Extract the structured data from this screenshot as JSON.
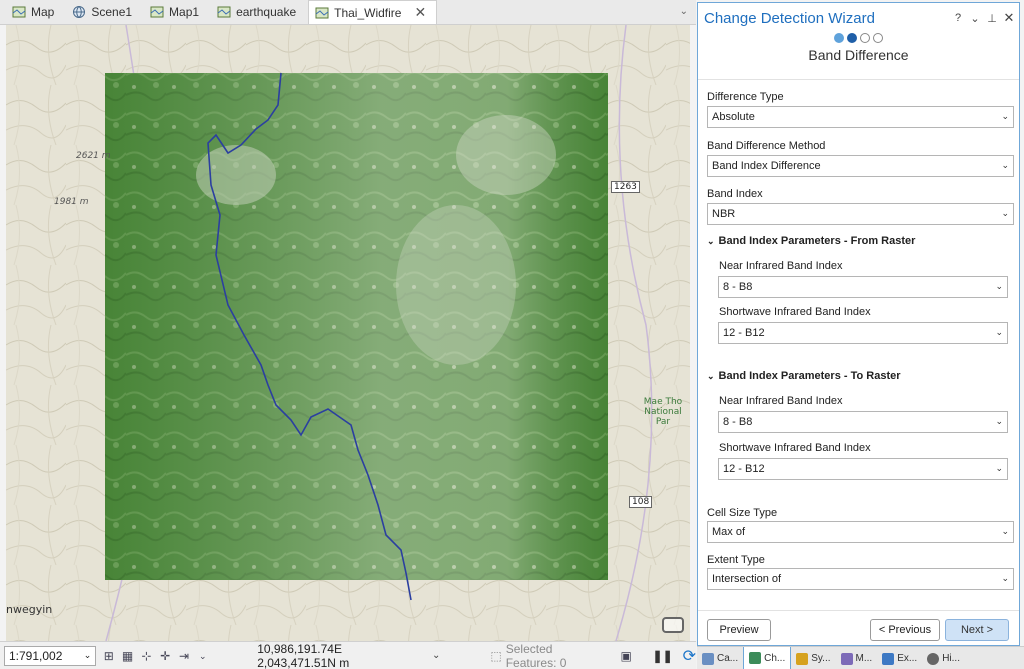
{
  "tabs": [
    {
      "label": "Map",
      "icon": "map-icon",
      "active": false
    },
    {
      "label": "Scene1",
      "icon": "globe-icon",
      "active": false
    },
    {
      "label": "Map1",
      "icon": "map-icon",
      "active": false
    },
    {
      "label": "earthquake",
      "icon": "map-icon",
      "active": false
    },
    {
      "label": "Thai_Widfire",
      "icon": "map-icon",
      "active": true
    }
  ],
  "map": {
    "labels": [
      "2621 m",
      "1981 m",
      "nwegyin",
      "Mae Tho National Par"
    ],
    "road_shields": [
      "1263",
      "108"
    ],
    "river_color": "#2b3fa0",
    "imagery_color": "#4a7d3a"
  },
  "status": {
    "scale": "1:791,002",
    "coordinates": "10,986,191.74E 2,043,471.51N m",
    "selected_features": "Selected Features: 0"
  },
  "panel": {
    "title": "Change Detection Wizard",
    "header_buttons": [
      "?",
      "v",
      "⊥",
      "✕"
    ],
    "steps_total": 4,
    "current_step": 2,
    "step_title": "Band Difference",
    "difference_type": {
      "label": "Difference Type",
      "value": "Absolute"
    },
    "band_difference_method": {
      "label": "Band Difference Method",
      "value": "Band Index Difference"
    },
    "band_index": {
      "label": "Band Index",
      "value": "NBR"
    },
    "from_raster": {
      "heading": "Band Index Parameters - From Raster",
      "nir_label": "Near Infrared Band Index",
      "nir_value": "8 - B8",
      "swir_label": "Shortwave Infrared Band Index",
      "swir_value": "12 - B12"
    },
    "to_raster": {
      "heading": "Band Index Parameters - To Raster",
      "nir_label": "Near Infrared Band Index",
      "nir_value": "8 - B8",
      "swir_label": "Shortwave Infrared Band Index",
      "swir_value": "12 - B12"
    },
    "cell_size_type": {
      "label": "Cell Size Type",
      "value": "Max of"
    },
    "extent_type": {
      "label": "Extent Type",
      "value": "Intersection of"
    },
    "preview_label": "Preview",
    "previous_label": "< Previous",
    "next_label": "Next >",
    "accent_color": "#1f6fbf"
  },
  "pane_tabs": [
    {
      "label": "Ca...",
      "active": false,
      "color": "#6a8fc2"
    },
    {
      "label": "Ch...",
      "active": true,
      "color": "#3c8c5a"
    },
    {
      "label": "Sy...",
      "active": false,
      "color": "#d6a21e"
    },
    {
      "label": "M...",
      "active": false,
      "color": "#7d6bb8"
    },
    {
      "label": "Ex...",
      "active": false,
      "color": "#3d79c4"
    },
    {
      "label": "Hi...",
      "active": false,
      "color": "#666666"
    }
  ]
}
